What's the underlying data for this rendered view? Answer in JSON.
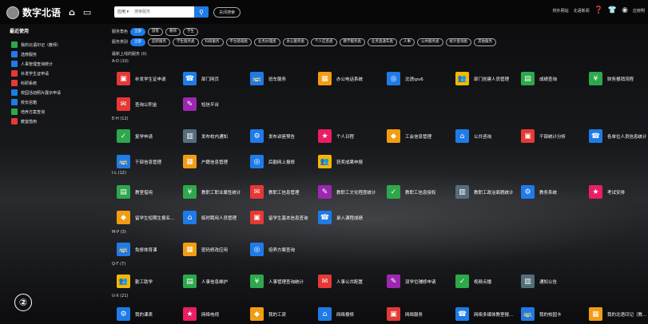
{
  "brand": {
    "title": "数字北语",
    "home_icon": "home-icon",
    "monitor_icon": "monitor-icon"
  },
  "search": {
    "select": "应用 ▾",
    "placeholder": "搜索服务",
    "close": "关闭搜索"
  },
  "topright": {
    "portal": "校外网站",
    "news": "北语新闻",
    "user": "庄晓明"
  },
  "sidebar": {
    "title": "最近使用",
    "items": [
      {
        "label": "我的北语印记（教师）",
        "color": "#2da84b"
      },
      {
        "label": "选修服务",
        "color": "#1e7be8"
      },
      {
        "label": "人事管理查询统计",
        "color": "#1e7be8"
      },
      {
        "label": "补发学生证申请",
        "color": "#e53935"
      },
      {
        "label": "科研系统",
        "color": "#e53935"
      },
      {
        "label": "校园活动照片展示申请",
        "color": "#1e7be8"
      },
      {
        "label": "校长信箱",
        "color": "#1e7be8"
      },
      {
        "label": "培养方案查询",
        "color": "#2da84b"
      },
      {
        "label": "教室借用",
        "color": "#e53935"
      }
    ]
  },
  "filters": {
    "role_label": "服务角色",
    "roles": [
      "全部",
      "游客",
      "教师",
      "学生"
    ],
    "cat_label": "服务类别",
    "cats": [
      "全部",
      "迎新服务",
      "学生服务类",
      "科研服务",
      "平台基础类",
      "业务办理类",
      "办公服务类",
      "个人信息类",
      "教学服务类",
      "业务直通车类",
      "人事",
      "公共服务类",
      "统计查询类",
      "其他服务"
    ]
  },
  "sections": [
    {
      "title": "最新上线的服务 (0)"
    },
    {
      "title": "A-D (10)"
    },
    {
      "title": "E-H (12)"
    },
    {
      "title": "I-L (12)"
    },
    {
      "title": "M-P (3)"
    },
    {
      "title": "Q-T (7)"
    },
    {
      "title": "U-X (21)"
    }
  ],
  "apps": {
    "r1": [
      "补发学生证申请",
      "部门网页",
      "班车服务",
      "办公电话系统",
      "北语ipv6",
      "部门创建人员管理",
      "成绩查询",
      "财务报销流程"
    ],
    "r2": [
      "查询公积金",
      "短信平台"
    ],
    "r3": [
      "复学申请",
      "发布校内通知",
      "发布讲座预告",
      "个人日程",
      "工会信息管理",
      "公共咨询",
      "干部统计分析",
      "各单位人员信息统计"
    ],
    "r4": [
      "干部信息管理",
      "户籍信息管理",
      "后勤网上报修",
      "获奖成果申报"
    ],
    "r5": [
      "教室借用",
      "教职工职业属性统计",
      "教职工信息管理",
      "教职工文化程度统计",
      "教职工信息授权",
      "教职工政治面貌统计",
      "教务系统",
      "考试安排"
    ],
    "r6": [
      "留学生短期生报名...",
      "临时聘用人员管理",
      "留学生基本信息查询",
      "录入课程成绩"
    ],
    "r7": [
      "免修体育课",
      "密码修改应用"
    ],
    "r8": [
      "培养方案查询"
    ],
    "r9": [
      "勤工助学",
      "人事信息维护",
      "人事管理查询统计",
      "人事公共配置",
      "双学位辅修申请",
      "视频点播",
      "通知公告"
    ],
    "r10": [
      "我的课表",
      "网络电视",
      "我的工资",
      "网络报修",
      "网络服务",
      "网络多媒体教室报...",
      "我的校园卡",
      "我的北语印记（教..."
    ]
  },
  "bottom": "②"
}
